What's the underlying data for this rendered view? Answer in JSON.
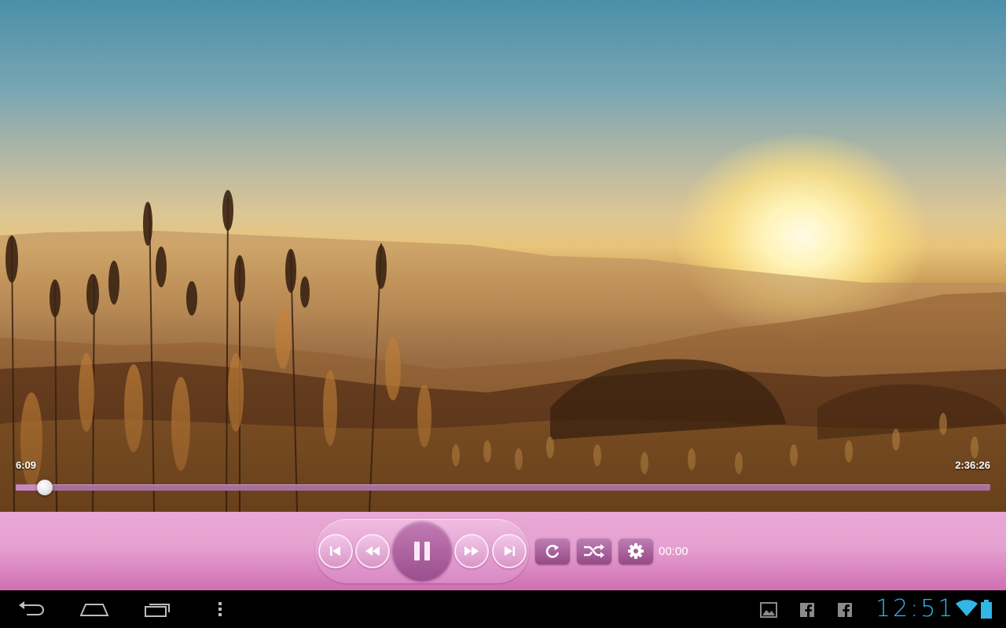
{
  "player": {
    "elapsed": "6:09",
    "duration": "2:36:26",
    "progress_fraction": 0.03,
    "sleep_timer": "00:00",
    "is_playing": true
  },
  "controls": {
    "icons": [
      "skip-previous-icon",
      "rewind-icon",
      "pause-icon",
      "fast-forward-icon",
      "skip-next-icon",
      "repeat-icon",
      "shuffle-icon",
      "gear-icon"
    ]
  },
  "system": {
    "clock": "12:51",
    "nav_icons": [
      "back-icon",
      "home-icon",
      "recent-apps-icon",
      "overflow-menu-icon"
    ],
    "notification_icons": [
      "gallery-icon",
      "facebook-icon",
      "facebook-icon"
    ],
    "status_icons": [
      "wifi-icon",
      "battery-icon"
    ]
  },
  "colors": {
    "control_bar": "#e6a0d0",
    "accent": "#9a4f8e",
    "clock": "#33b5e5"
  }
}
